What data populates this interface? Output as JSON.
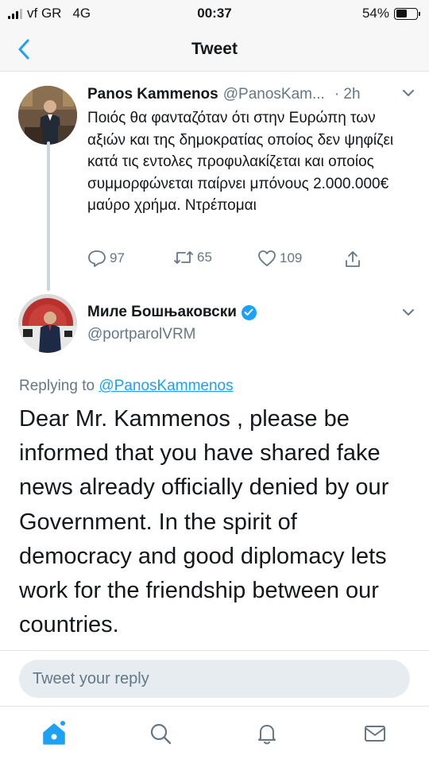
{
  "status_bar": {
    "carrier": "vf GR",
    "network": "4G",
    "time": "00:37",
    "battery": "54%",
    "battery_level": 0.54
  },
  "header": {
    "title": "Tweet",
    "back_icon": "chevron-left-icon"
  },
  "parent_tweet": {
    "name": "Panos Kammenos",
    "handle": "@PanosKam...",
    "time": "· 2h",
    "text": "Ποιός θα φανταζόταν ότι στην Ευρώπη των αξιών και της δημοκρατίας οποίος δεν ψηφίζει κατά τις εντολες προφυλακίζεται και οποίος συμμορφώνεται παίρνει μπόνους 2.000.000€ μαύρο χρήμα. Ντρέπομαι",
    "actions": {
      "replies": "97",
      "retweets": "65",
      "likes": "109"
    }
  },
  "reply_tweet": {
    "name": "Миле Бошњаковски",
    "handle": "@portparolVRM",
    "replying_prefix": "Replying to",
    "replying_to": "@PanosKammenos",
    "text": "Dear Mr. Kammenos , please be informed that you have shared fake news already officially denied by our Government. In the spirit of democracy and good diplomacy lets work for the friendship between our countries."
  },
  "reply_bar": {
    "placeholder": "Tweet your reply"
  },
  "tab_bar": {
    "items": [
      "home-icon",
      "search-icon",
      "notifications-icon",
      "messages-icon"
    ],
    "accent": "#1da1f2"
  },
  "colors": {
    "accent": "#1da1f2",
    "secondary_text": "#657786",
    "text": "#14171a"
  }
}
